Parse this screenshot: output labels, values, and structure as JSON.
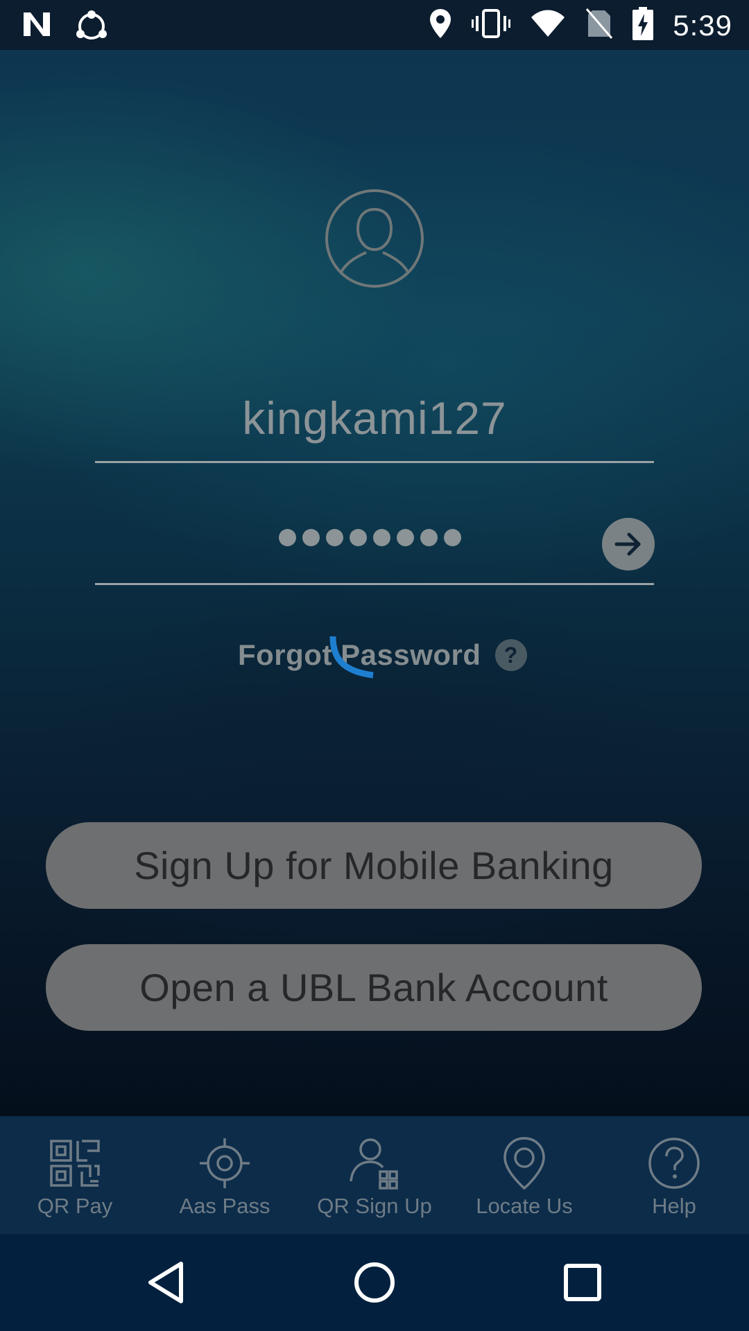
{
  "status_bar": {
    "time": "5:39",
    "left_icons": [
      "n-logo-icon",
      "share-nodes-icon"
    ],
    "right_icons": [
      "location-pin-icon",
      "vibrate-icon",
      "wifi-icon",
      "no-sim-icon",
      "battery-charging-icon"
    ]
  },
  "login": {
    "avatar_icon": "user-avatar-icon",
    "username": "kingkami127",
    "password_masked_length": 8,
    "submit_icon": "arrow-right-icon",
    "forgot_password_label": "Forgot Password",
    "forgot_help_label": "?",
    "loading": true
  },
  "buttons": {
    "signup_label": "Sign Up for Mobile Banking",
    "open_account_label": "Open a UBL Bank Account"
  },
  "bottom_tabs": [
    {
      "label": "QR Pay",
      "icon": "qr-code-icon"
    },
    {
      "label": "Aas Pass",
      "icon": "target-location-icon"
    },
    {
      "label": "QR Sign Up",
      "icon": "user-qr-icon"
    },
    {
      "label": "Locate Us",
      "icon": "map-pin-icon"
    },
    {
      "label": "Help",
      "icon": "question-circle-icon"
    }
  ],
  "nav_bar": [
    "back-triangle-icon",
    "home-circle-icon",
    "recents-square-icon"
  ],
  "colors": {
    "accent_spinner": "#1e7fd0",
    "tab_bar": "#0c2c4a",
    "button_fill": "#6e6f70"
  }
}
